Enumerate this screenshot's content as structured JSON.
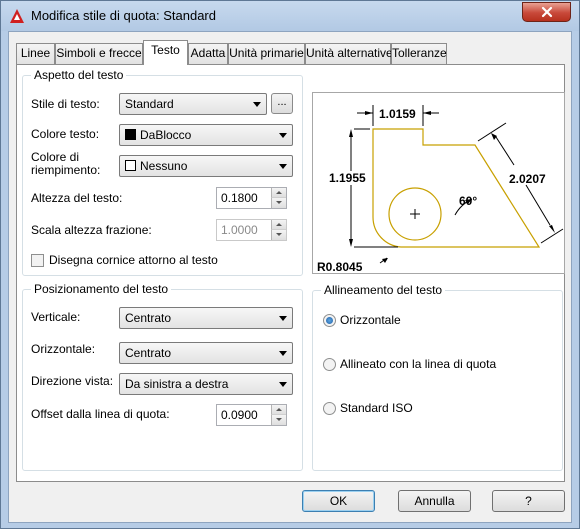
{
  "window": {
    "title": "Modifica stile di quota: Standard"
  },
  "tabs": [
    {
      "label": "Linee"
    },
    {
      "label": "Simboli e frecce"
    },
    {
      "label": "Testo",
      "active": true
    },
    {
      "label": "Adatta"
    },
    {
      "label": "Unità primarie"
    },
    {
      "label": "Unità alternative"
    },
    {
      "label": "Tolleranze"
    }
  ],
  "text_appearance": {
    "group_title": "Aspetto del testo",
    "text_style_label": "Stile di testo:",
    "text_style_value": "Standard",
    "text_style_browse": "...",
    "text_color_label": "Colore testo:",
    "text_color_value": "DaBlocco",
    "fill_color_label": "Colore di riempimento:",
    "fill_color_value": "Nessuno",
    "text_height_label": "Altezza del testo:",
    "text_height_value": "0.1800",
    "fraction_scale_label": "Scala altezza frazione:",
    "fraction_scale_value": "1.0000",
    "draw_frame_label": "Disegna cornice attorno al testo",
    "draw_frame_checked": false
  },
  "text_placement": {
    "group_title": "Posizionamento del testo",
    "vertical_label": "Verticale:",
    "vertical_value": "Centrato",
    "horizontal_label": "Orizzontale:",
    "horizontal_value": "Centrato",
    "view_direction_label": "Direzione vista:",
    "view_direction_value": "Da sinistra a destra",
    "offset_label": "Offset dalla linea di quota:",
    "offset_value": "0.0900"
  },
  "text_alignment": {
    "group_title": "Allineamento del testo",
    "options": [
      {
        "label": "Orizzontale",
        "selected": true
      },
      {
        "label": "Allineato con la linea di quota",
        "selected": false
      },
      {
        "label": "Standard ISO",
        "selected": false
      }
    ]
  },
  "preview": {
    "dim_top": "1.0159",
    "dim_left": "1.1955",
    "dim_right": "2.0207",
    "dim_angle": "60°",
    "dim_radius": "R0.8045"
  },
  "buttons": {
    "ok": "OK",
    "cancel": "Annulla",
    "help": "?"
  },
  "colors": {
    "accent": "#1f5fa8",
    "preview_geometry": "#c8a000",
    "close_button": "#c8493a"
  },
  "icons": {
    "app": "autocad-logo-icon",
    "close": "close-icon"
  }
}
